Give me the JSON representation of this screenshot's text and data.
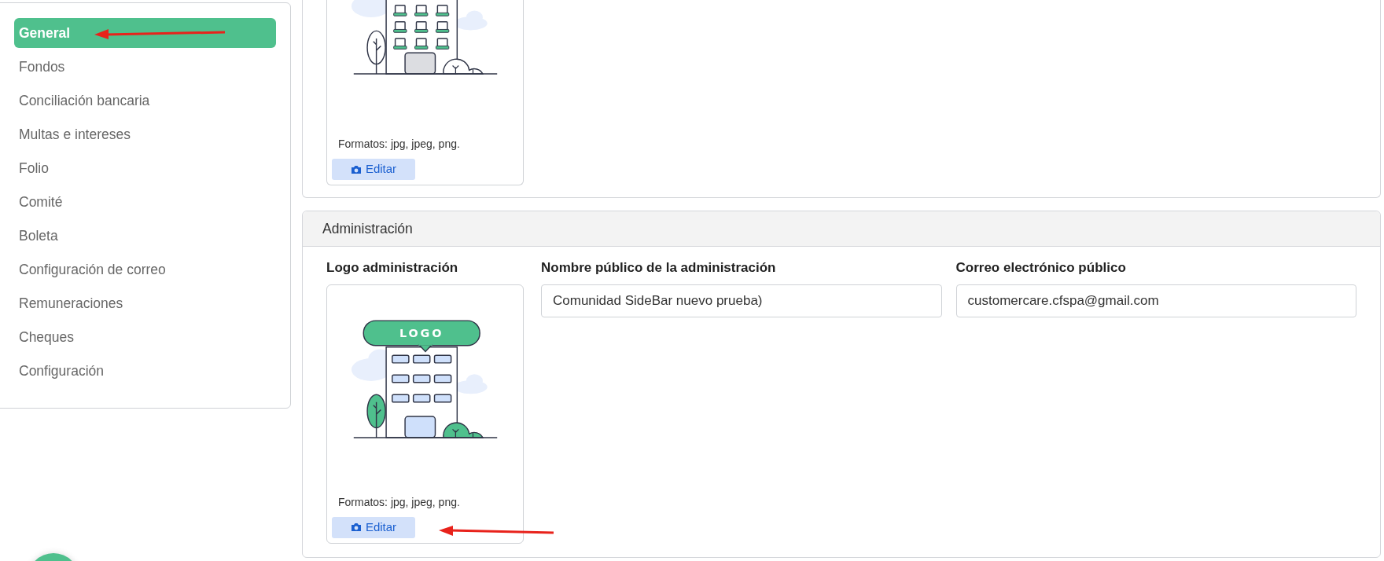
{
  "sidebar": {
    "items": [
      {
        "label": "General",
        "selected": true
      },
      {
        "label": "Fondos",
        "selected": false
      },
      {
        "label": "Conciliación bancaria",
        "selected": false
      },
      {
        "label": "Multas e intereses",
        "selected": false
      },
      {
        "label": "Folio",
        "selected": false
      },
      {
        "label": "Comité",
        "selected": false
      },
      {
        "label": "Boleta",
        "selected": false
      },
      {
        "label": "Configuración de correo",
        "selected": false
      },
      {
        "label": "Remuneraciones",
        "selected": false
      },
      {
        "label": "Cheques",
        "selected": false
      },
      {
        "label": "Configuración",
        "selected": false
      }
    ]
  },
  "top_section": {
    "logo_upload": {
      "formats": "Formatos: jpg, jpeg, png.",
      "button": "Editar"
    }
  },
  "administration": {
    "title": "Administración",
    "logo_label": "Logo administración",
    "logo_upload": {
      "logo_text": "LOGO",
      "formats": "Formatos: jpg, jpeg, png.",
      "button": "Editar"
    },
    "fields": [
      {
        "label": "Nombre público de la administración",
        "value": "Comunidad SideBar nuevo prueba)"
      },
      {
        "label": "Correo electrónico público",
        "value": "customercare.cfspa@gmail.com"
      }
    ]
  }
}
